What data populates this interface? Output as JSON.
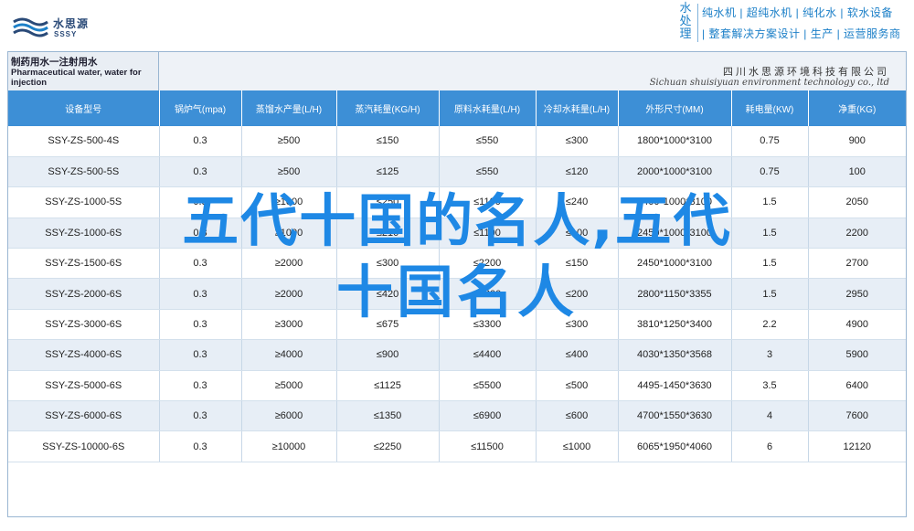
{
  "header": {
    "logo_name": "水思源",
    "logo_sub": "SSSY",
    "brand_vertical": "水处理",
    "slogan_line1": "纯水机 | 超纯水机 | 纯化水 | 软水设备",
    "slogan_line2": "| 整套解决方案设计 | 生产 | 运营服务商",
    "brand_color": "#1d80c8"
  },
  "caption": {
    "title_cn": "制药用水一注射用水",
    "title_en": "Pharmaceutical water, water for injection",
    "company_cn": "四川水思源环境科技有限公司",
    "company_en": "Sichuan shuisiyuan environment technology co., ltd"
  },
  "table": {
    "columns": [
      "设备型号",
      "锅炉气(mpa)",
      "蒸馏水产量(L/H)",
      "蒸汽耗量(KG/H)",
      "原料水耗量(L/H)",
      "冷却水耗量(L/H)",
      "外形尺寸(MM)",
      "耗电量(KW)",
      "净重(KG)"
    ],
    "rows": [
      [
        "SSY-ZS-500-4S",
        "0.3",
        "≥500",
        "≤150",
        "≤550",
        "≤300",
        "1800*1000*3100",
        "0.75",
        "900"
      ],
      [
        "SSY-ZS-500-5S",
        "0.3",
        "≥500",
        "≤125",
        "≤550",
        "≤120",
        "2000*1000*3100",
        "0.75",
        "100"
      ],
      [
        "SSY-ZS-1000-5S",
        "0.3",
        "≥1000",
        "≤250",
        "≤1100",
        "≤240",
        "2400*1000*3100",
        "1.5",
        "2050"
      ],
      [
        "SSY-ZS-1000-6S",
        "0.3",
        "≥1000",
        "≤210",
        "≤1100",
        "≤100",
        "2450*1000*3100",
        "1.5",
        "2200"
      ],
      [
        "SSY-ZS-1500-6S",
        "0.3",
        "≥2000",
        "≤300",
        "≤2200",
        "≤150",
        "2450*1000*3100",
        "1.5",
        "2700"
      ],
      [
        "SSY-ZS-2000-6S",
        "0.3",
        "≥2000",
        "≤420",
        "≤2200",
        "≤200",
        "2800*1150*3355",
        "1.5",
        "2950"
      ],
      [
        "SSY-ZS-3000-6S",
        "0.3",
        "≥3000",
        "≤675",
        "≤3300",
        "≤300",
        "3810*1250*3400",
        "2.2",
        "4900"
      ],
      [
        "SSY-ZS-4000-6S",
        "0.3",
        "≥4000",
        "≤900",
        "≤4400",
        "≤400",
        "4030*1350*3568",
        "3",
        "5900"
      ],
      [
        "SSY-ZS-5000-6S",
        "0.3",
        "≥5000",
        "≤1125",
        "≤5500",
        "≤500",
        "4495-1450*3630",
        "3.5",
        "6400"
      ],
      [
        "SSY-ZS-6000-6S",
        "0.3",
        "≥6000",
        "≤1350",
        "≤6900",
        "≤600",
        "4700*1550*3630",
        "4",
        "7600"
      ],
      [
        "SSY-ZS-10000-6S",
        "0.3",
        "≥10000",
        "≤2250",
        "≤11500",
        "≤1000",
        "6065*1950*4060",
        "6",
        "12120"
      ]
    ],
    "header_color": "#3d8fd6",
    "stripe_color": "#e7eef6"
  },
  "overlay": {
    "line1": "五代十国的名人,五代",
    "line2": "十国名人",
    "color": "#1e88e5"
  }
}
